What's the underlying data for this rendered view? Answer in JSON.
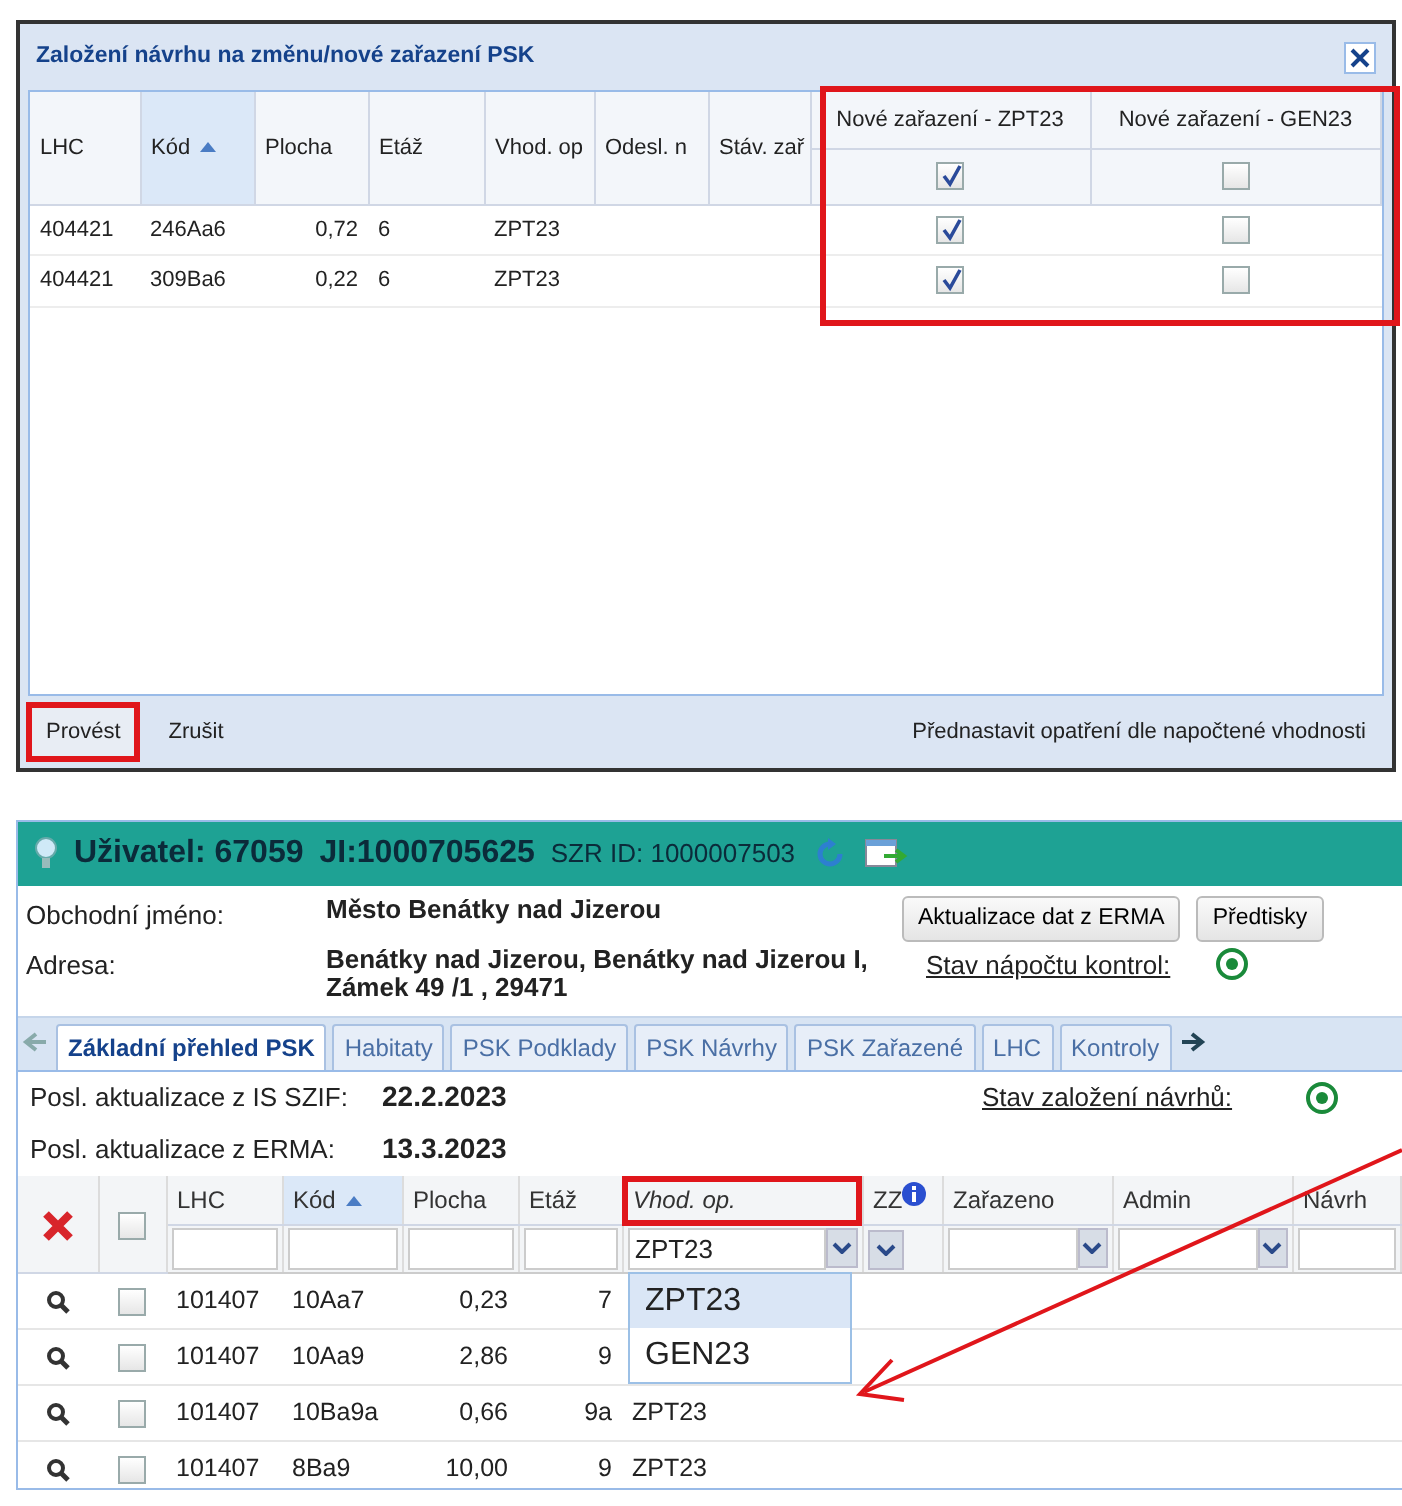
{
  "dialog": {
    "title": "Založení návrhu na změnu/nové zařazení PSK",
    "columns": [
      {
        "label": "LHC",
        "sorted": false
      },
      {
        "label": "Kód",
        "sorted": true
      },
      {
        "label": "Plocha",
        "sorted": false
      },
      {
        "label": "Etáž",
        "sorted": false
      },
      {
        "label": "Vhod. op",
        "sorted": false
      },
      {
        "label": "Odesl. n",
        "sorted": false
      },
      {
        "label": "Stáv. zař",
        "sorted": false
      }
    ],
    "check_columns": [
      {
        "label": "Nové zařazení - ZPT23",
        "header_checked": true
      },
      {
        "label": "Nové zařazení - GEN23",
        "header_checked": false
      }
    ],
    "rows": [
      {
        "cells": [
          "404421",
          "246Aa6",
          "0,72",
          "6",
          "ZPT23"
        ],
        "checks": [
          true,
          false
        ]
      },
      {
        "cells": [
          "404421",
          "309Ba6",
          "0,22",
          "6",
          "ZPT23"
        ],
        "checks": [
          true,
          false
        ]
      }
    ],
    "buttons": [
      {
        "label": "Provést",
        "highlighted": true
      },
      {
        "label": "Zrušit",
        "highlighted": false
      }
    ],
    "preset_button": "Přednastavit opatření dle napočtené vhodnosti"
  },
  "panel": {
    "user": "Uživatel: 67059",
    "ji": "JI:1000705625",
    "szr": "SZR ID: 1000007503",
    "info": [
      {
        "label": "Obchodní jméno:",
        "value": "Město Benátky nad Jizerou"
      },
      {
        "label": "Adresa:",
        "value": "Benátky nad Jizerou, Benátky nad Jizerou I, Zámek 49 /1 , 29471"
      }
    ],
    "buttons": [
      "Aktualizace dat z ERMA",
      "Předtisky"
    ],
    "status_links": [
      "Stav nápočtu kontrol:",
      "Stav založení návrhů:"
    ],
    "tabs": [
      {
        "label": "Základní přehled PSK",
        "selected": true
      },
      {
        "label": "Habitaty",
        "selected": false
      },
      {
        "label": "PSK Podklady",
        "selected": false
      },
      {
        "label": "PSK Návrhy",
        "selected": false
      },
      {
        "label": "PSK Zařazené",
        "selected": false
      },
      {
        "label": "LHC",
        "selected": false
      },
      {
        "label": "Kontroly",
        "selected": false
      }
    ],
    "updates": [
      {
        "label": "Posl. aktualizace z IS SZIF:",
        "value": "22.2.2023"
      },
      {
        "label": "Posl. aktualizace z ERMA:",
        "value": "13.3.2023"
      }
    ],
    "grid": {
      "select_all_checked": false,
      "columns": [
        {
          "kind": "text",
          "label": "LHC",
          "filter": {
            "kind": "text"
          }
        },
        {
          "kind": "text",
          "label": "Kód",
          "sorted": true,
          "filter": {
            "kind": "text"
          }
        },
        {
          "kind": "text",
          "label": "Plocha",
          "filter": {
            "kind": "text"
          }
        },
        {
          "kind": "text",
          "label": "Etáž",
          "filter": {
            "kind": "text"
          }
        },
        {
          "kind": "highlight",
          "label": "Vhod. op.",
          "filter": {
            "kind": "combo",
            "value": "ZPT23"
          }
        },
        {
          "kind": "info",
          "label": "ZZ",
          "filter": {
            "kind": "button"
          }
        },
        {
          "kind": "text",
          "label": "Zařazeno",
          "filter": {
            "kind": "combo"
          }
        },
        {
          "kind": "text",
          "label": "Admin",
          "filter": {
            "kind": "combo"
          }
        },
        {
          "kind": "text",
          "label": "Návrh",
          "filter": {
            "kind": "text"
          }
        }
      ],
      "dropdown": [
        {
          "label": "ZPT23",
          "selected": true
        },
        {
          "label": "GEN23",
          "selected": false
        }
      ],
      "rows": [
        {
          "checked": false,
          "cells": [
            "101407",
            "10Aa7",
            "0,23",
            "7"
          ]
        },
        {
          "checked": false,
          "cells": [
            "101407",
            "10Aa9",
            "2,86",
            "9"
          ]
        },
        {
          "checked": false,
          "cells": [
            "101407",
            "10Ba9a",
            "0,66",
            "9a",
            "ZPT23"
          ]
        },
        {
          "checked": false,
          "cells": [
            "101407",
            "8Ba9",
            "10,00",
            "9",
            "ZPT23"
          ]
        }
      ]
    }
  }
}
